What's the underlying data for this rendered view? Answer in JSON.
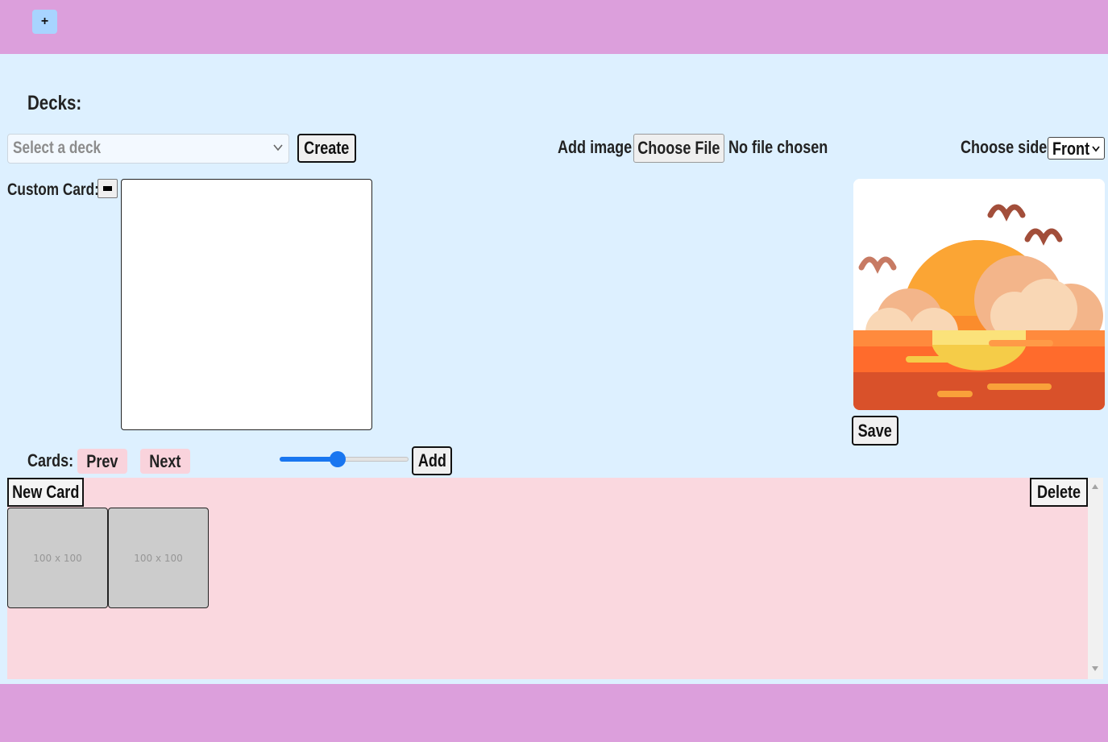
{
  "header": {
    "add_button_label": "+"
  },
  "decks": {
    "label": "Decks:",
    "select_placeholder": "Select a deck",
    "create_label": "Create"
  },
  "image_upload": {
    "label": "Add image:",
    "button_label": "Choose File",
    "status": "No file chosen"
  },
  "side": {
    "label": "Choose side:",
    "selected": "Front"
  },
  "custom_card": {
    "label": "Custom Card:",
    "color": "#000000"
  },
  "preview": {
    "save_label": "Save"
  },
  "cards": {
    "label": "Cards:",
    "prev_label": "Prev",
    "next_label": "Next",
    "slider_value": 0.45,
    "add_label": "Add",
    "new_card_label": "New Card",
    "delete_label": "Delete",
    "thumbnails": [
      "100 x 100",
      "100 x 100"
    ]
  },
  "colors": {
    "bar": "#dc9fdc",
    "background": "#ddf0ff",
    "panel": "#fad8df",
    "accent": "#1976f0"
  },
  "icons": {
    "add": "plus-icon",
    "dropdown": "chevron-down-icon",
    "preview_image": "sunset-illustration"
  }
}
